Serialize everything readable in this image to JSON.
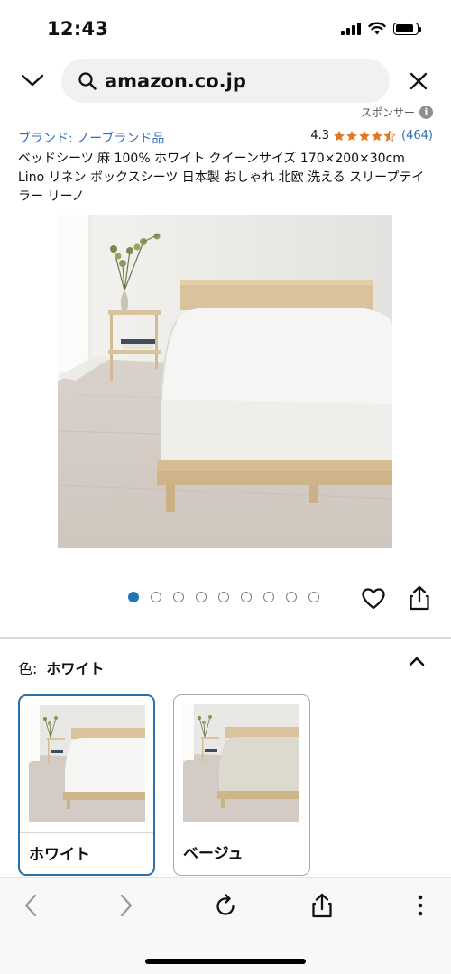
{
  "status_bar": {
    "time": "12:43"
  },
  "browser": {
    "url": "amazon.co.jp",
    "icons": [
      "chevron-down-icon",
      "search-icon",
      "close-icon"
    ]
  },
  "sponsor": {
    "label": "スポンサー",
    "icon": "info-icon"
  },
  "product": {
    "brand": "ブランド: ノーブランド品",
    "rating": {
      "score": "4.3",
      "count": "(464)",
      "stars_value": 4.3,
      "star_color": "#de7921"
    },
    "title": "ベッドシーツ 麻 100% ホワイト クイーンサイズ 170×200×30cm Lino リネン ボックスシーツ 日本製 おしゃれ 北欧 洗える スリープテイラー リーノ"
  },
  "carousel": {
    "total": 9,
    "active_index": 0,
    "active_color": "#2176b8"
  },
  "actions": [
    "heart-icon",
    "share-icon"
  ],
  "color_selector": {
    "key": "色:",
    "value": "ホワイト",
    "options": [
      {
        "name": "ホワイト",
        "selected": true
      },
      {
        "name": "ベージュ",
        "selected": false
      }
    ]
  },
  "toolbar": {
    "icons": [
      "back-arrow-icon",
      "forward-arrow-icon",
      "reload-icon",
      "share-icon",
      "more-vertical-icon"
    ]
  },
  "colors": {
    "link": "#2f6eb5",
    "selected_border": "#2a6fa8",
    "star": "#de7921"
  }
}
